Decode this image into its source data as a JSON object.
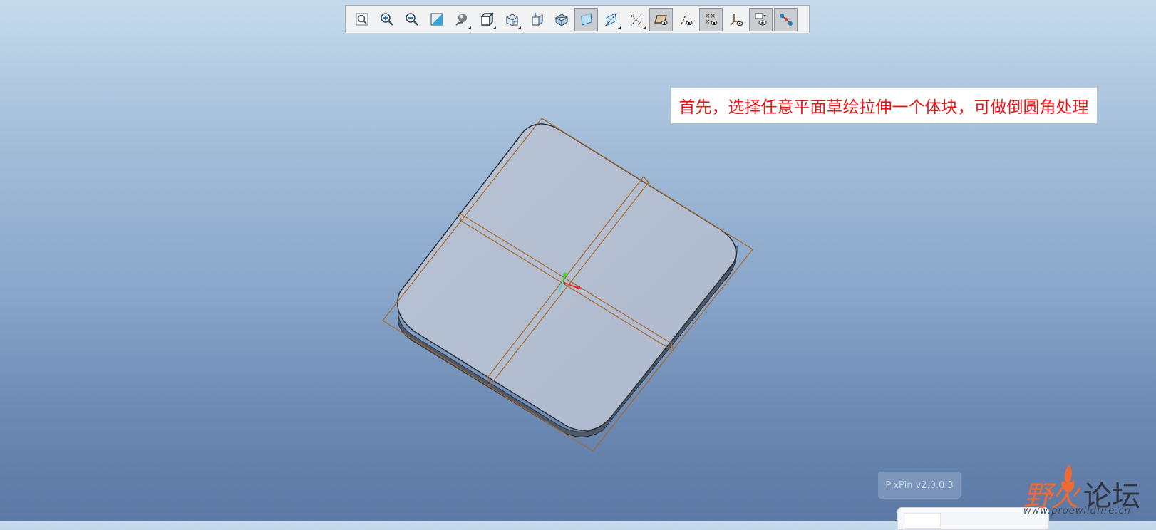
{
  "toolbar": {
    "buttons": [
      {
        "name": "refit-icon",
        "active": false,
        "dropdown": false
      },
      {
        "name": "zoom-in-icon",
        "active": false,
        "dropdown": false
      },
      {
        "name": "zoom-out-icon",
        "active": false,
        "dropdown": false
      },
      {
        "name": "repaint-icon",
        "active": false,
        "dropdown": false
      },
      {
        "name": "display-style-icon",
        "active": false,
        "dropdown": true
      },
      {
        "name": "saved-orientations-icon",
        "active": false,
        "dropdown": true
      },
      {
        "name": "view-manager-icon",
        "active": false,
        "dropdown": true
      },
      {
        "name": "perspective-view-icon",
        "active": false,
        "dropdown": false
      },
      {
        "name": "section-view-icon",
        "active": false,
        "dropdown": false
      },
      {
        "name": "plane-display-icon",
        "active": true,
        "dropdown": false
      },
      {
        "name": "axis-display-icon",
        "active": false,
        "dropdown": true
      },
      {
        "name": "point-display-icon",
        "active": false,
        "dropdown": true
      },
      {
        "name": "plane-tag-display-icon",
        "active": true,
        "dropdown": false
      },
      {
        "name": "axis-tag-display-icon",
        "active": false,
        "dropdown": false
      },
      {
        "name": "point-tag-display-icon",
        "active": true,
        "dropdown": false
      },
      {
        "name": "csys-display-icon",
        "active": false,
        "dropdown": false
      },
      {
        "name": "spin-center-icon",
        "active": true,
        "dropdown": false
      },
      {
        "name": "annotation-display-icon",
        "active": true,
        "dropdown": false
      }
    ]
  },
  "annotation": {
    "text": "首先，选择任意平面草绘拉伸一个体块，可做倒圆角处理"
  },
  "watermark": {
    "pixpin": "PixPin v2.0.0.3",
    "logo_part1": "野火",
    "logo_part2": "论坛",
    "url": "www.proewildfire.cn"
  },
  "colors": {
    "annotation_text": "#e8141a",
    "part_face": "#b3bfd2",
    "datum_plane": "#a8672a",
    "logo_accent": "#f06a33"
  }
}
